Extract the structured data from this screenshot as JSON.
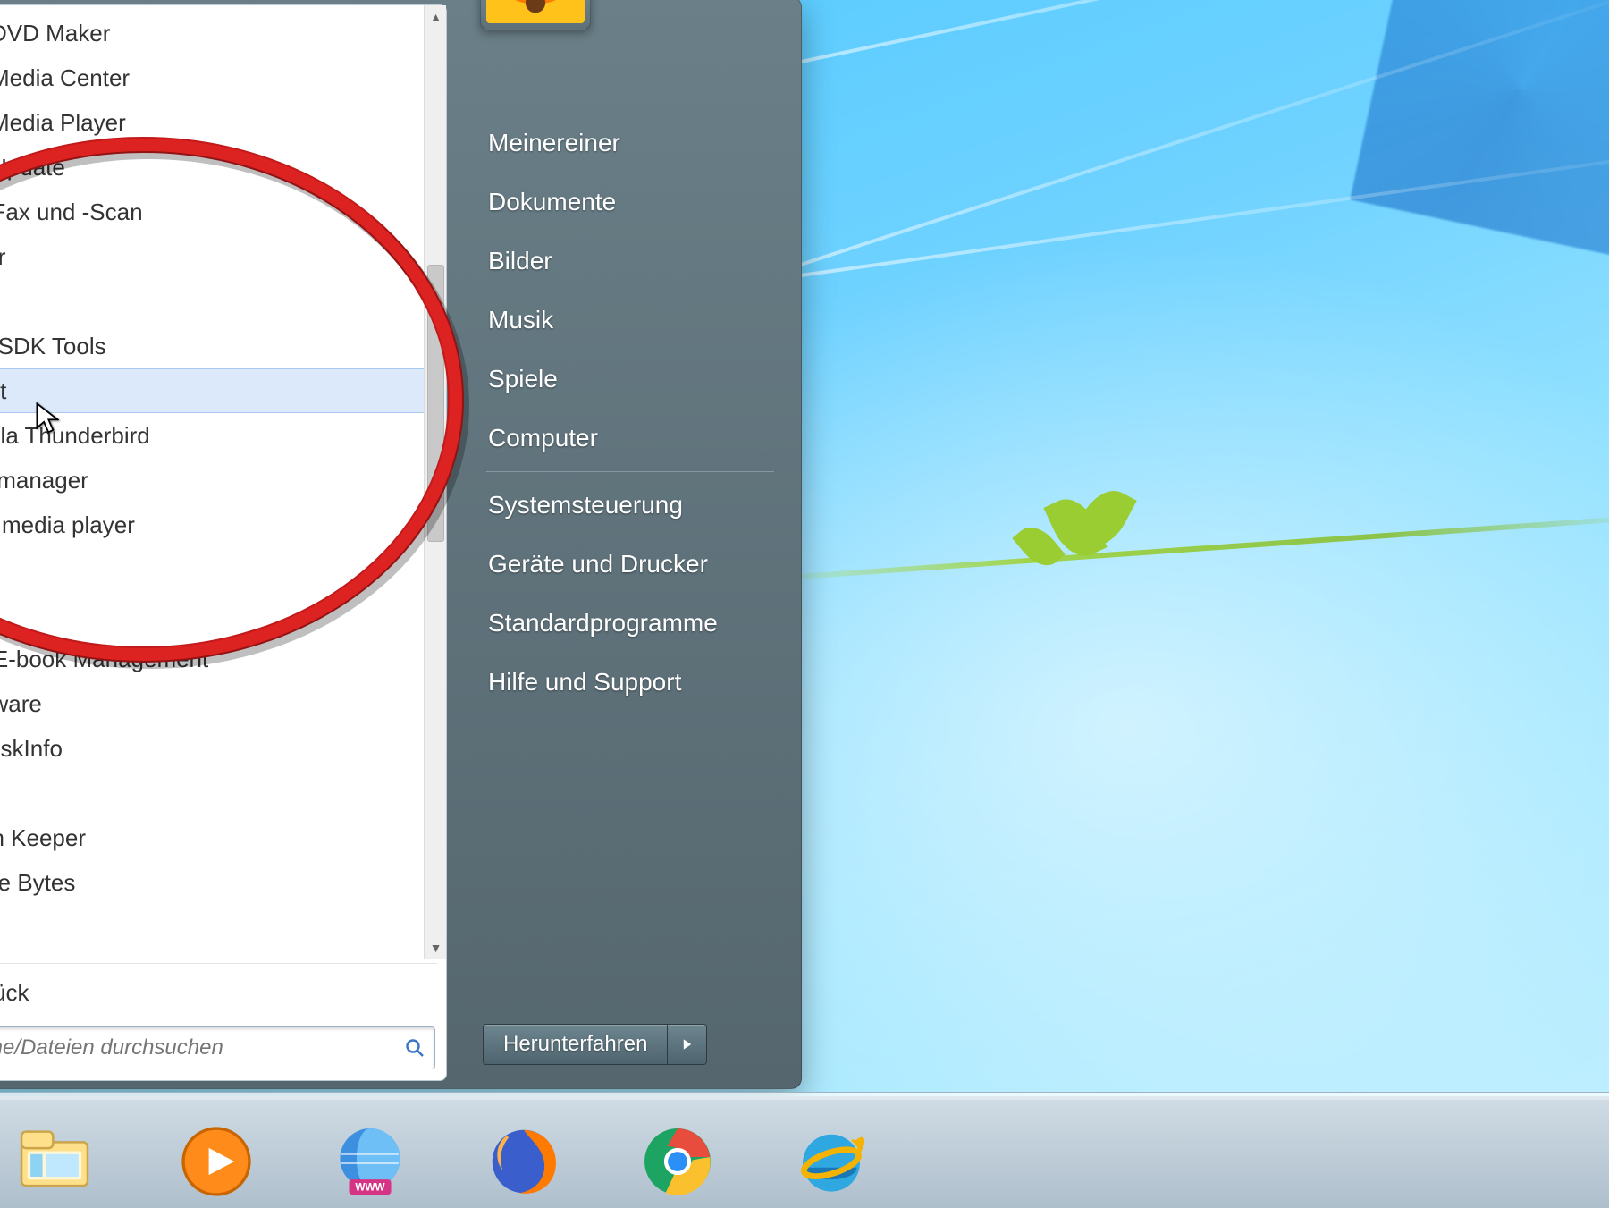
{
  "programs": [
    {
      "label": "ws DVD Maker",
      "type": "item"
    },
    {
      "label": "ws Media Center",
      "type": "item"
    },
    {
      "label": "ws Media Player",
      "type": "item"
    },
    {
      "label": "ws Update",
      "type": "item"
    },
    {
      "label": "ws-Fax und -Scan",
      "type": "item"
    },
    {
      "label": "ewer",
      "type": "item"
    },
    {
      "label": "",
      "type": "folder"
    },
    {
      "label": "d SDK Tools",
      "type": "folder"
    },
    {
      "label": "art",
      "type": "folder",
      "selected": true
    },
    {
      "label": "zilla Thunderbird",
      "type": "folder"
    },
    {
      "label": "tzmanager",
      "type": "folder"
    },
    {
      "label": "C media player",
      "type": "folder"
    },
    {
      "label": "",
      "type": "folder"
    },
    {
      "label": "",
      "type": "folder"
    },
    {
      "label": " - E-book Management",
      "type": "folder"
    },
    {
      "label": "aware",
      "type": "folder"
    },
    {
      "label": "DiskInfo",
      "type": "folder"
    },
    {
      "label": "",
      "type": "folder"
    },
    {
      "label": "on Keeper",
      "type": "folder"
    },
    {
      "label": "ute Bytes",
      "type": "folder"
    }
  ],
  "back_label": "ück",
  "search_placeholder": "mme/Dateien durchsuchen",
  "right_pane": {
    "user": "Meinereiner",
    "items_top": [
      "Dokumente",
      "Bilder",
      "Musik",
      "Spiele",
      "Computer"
    ],
    "items_bottom": [
      "Systemsteuerung",
      "Geräte und Drucker",
      "Standardprogramme",
      "Hilfe und Support"
    ]
  },
  "shutdown_label": "Herunterfahren",
  "taskbar_apps": [
    "explorer",
    "wmp",
    "browser-www",
    "firefox",
    "chrome",
    "ie"
  ]
}
